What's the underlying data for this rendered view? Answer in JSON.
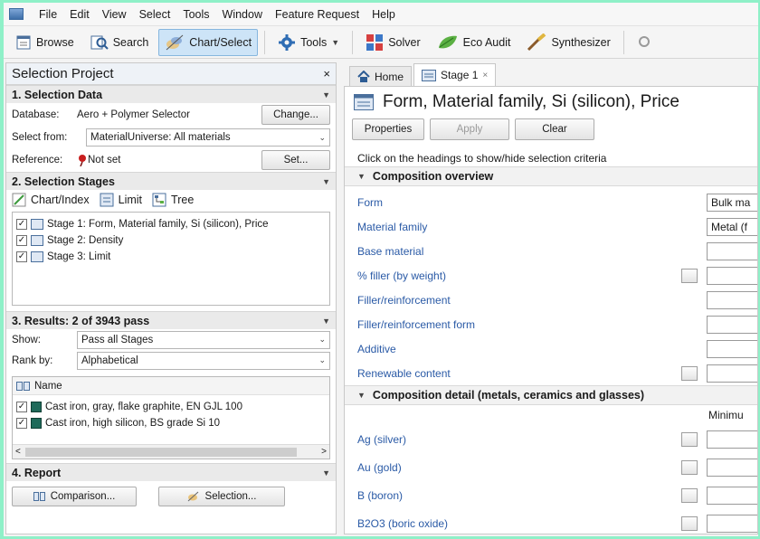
{
  "menu": [
    "File",
    "Edit",
    "View",
    "Select",
    "Tools",
    "Window",
    "Feature Request",
    "Help"
  ],
  "toolbar": {
    "browse": "Browse",
    "search": "Search",
    "chart_select": "Chart/Select",
    "tools": "Tools",
    "solver": "Solver",
    "eco_audit": "Eco Audit",
    "synthesizer": "Synthesizer"
  },
  "left": {
    "title": "Selection Project",
    "close": "×",
    "sec1": {
      "title": "1. Selection Data",
      "database_label": "Database:",
      "database_value": "Aero + Polymer Selector",
      "change_button": "Change...",
      "select_from_label": "Select from:",
      "select_from_value": "MaterialUniverse: All materials",
      "reference_label": "Reference:",
      "reference_value": "Not set",
      "set_button": "Set..."
    },
    "sec2": {
      "title": "2. Selection Stages",
      "chart_index": "Chart/Index",
      "limit": "Limit",
      "tree": "Tree",
      "stages": [
        "Stage 1: Form, Material family, Si (silicon), Price",
        "Stage 2: Density",
        "Stage 3: Limit"
      ]
    },
    "sec3": {
      "title": "3. Results: 2 of 3943 pass",
      "show_label": "Show:",
      "show_value": "Pass all Stages",
      "rank_label": "Rank by:",
      "rank_value": "Alphabetical",
      "name_header": "Name",
      "results": [
        "Cast iron, gray, flake graphite, EN GJL 100",
        "Cast iron, high silicon, BS grade Si 10"
      ]
    },
    "sec4": {
      "title": "4. Report",
      "comparison": "Comparison...",
      "selection": "Selection..."
    }
  },
  "right": {
    "tab_home": "Home",
    "tab_stage": "Stage 1",
    "tab_close": "×",
    "stage_title": "Form, Material family, Si (silicon), Price",
    "properties": "Properties",
    "apply": "Apply",
    "clear": "Clear",
    "hint": "Click on the headings to show/hide selection criteria",
    "group1": "Composition overview",
    "group2": "Composition detail (metals, ceramics and glasses)",
    "minimum": "Minimu",
    "props1": [
      {
        "label": "Form",
        "value": "Bulk ma",
        "icon": false
      },
      {
        "label": "Material family",
        "value": "Metal (f",
        "icon": false
      },
      {
        "label": "Base material",
        "value": "",
        "icon": false
      },
      {
        "label": "% filler (by weight)",
        "value": "",
        "icon": true
      },
      {
        "label": "Filler/reinforcement",
        "value": "",
        "icon": false
      },
      {
        "label": "Filler/reinforcement form",
        "value": "",
        "icon": false
      },
      {
        "label": "Additive",
        "value": "",
        "icon": false
      },
      {
        "label": "Renewable content",
        "value": "",
        "icon": true
      }
    ],
    "props2": [
      {
        "label": "Ag (silver)"
      },
      {
        "label": "Au (gold)"
      },
      {
        "label": "B (boron)"
      },
      {
        "label": "B2O3 (boric oxide)"
      }
    ]
  }
}
